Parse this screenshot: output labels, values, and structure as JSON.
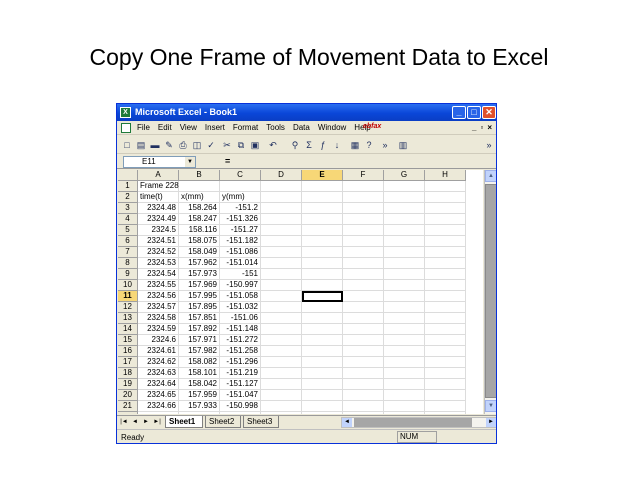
{
  "slide_title": "Copy One Frame of Movement Data to Excel",
  "window": {
    "app_icon": "X",
    "title": "Microsoft Excel - Book1",
    "minimize_glyph": "_",
    "maximize_glyph": "□",
    "close_glyph": "✕"
  },
  "menu": {
    "items": [
      "File",
      "Edit",
      "View",
      "Insert",
      "Format",
      "Tools",
      "Data",
      "Window",
      "Help"
    ],
    "ask_box": "ebfax",
    "doc_controls": [
      "_",
      "▫",
      "×"
    ]
  },
  "toolbar": {
    "icons": [
      "new-icon",
      "open-icon",
      "save-icon",
      "permission-icon",
      "print-icon",
      "print-preview-icon",
      "spelling-icon",
      "cut-icon",
      "copy-icon",
      "paste-icon",
      "undo-icon",
      "hyperlink-icon",
      "autosum-icon",
      "function-icon",
      "sort-ascending-icon",
      "chart-wizard-icon",
      "help-icon",
      "more-icon",
      "borders-icon"
    ],
    "glyphs": [
      "□",
      "▤",
      "▬",
      "✎",
      "⎙",
      "◫",
      "✓",
      "✂",
      "⧉",
      "▣",
      "↶",
      "⚲",
      "Σ",
      "ƒ",
      "↓",
      "▦",
      "?",
      "»",
      "▥"
    ],
    "overflow": "»"
  },
  "formula_bar": {
    "name_box": "E11",
    "name_box_dropdown": "▼",
    "equals": "="
  },
  "columns": [
    "A",
    "B",
    "C",
    "D",
    "E",
    "F",
    "G",
    "H"
  ],
  "active_column": "E",
  "active_row": "11",
  "rows": [
    {
      "n": "1",
      "cells": [
        "Frame 228",
        "",
        ""
      ]
    },
    {
      "n": "2",
      "cells": [
        "time(t)",
        "x(mm)",
        "y(mm)"
      ]
    },
    {
      "n": "3",
      "cells": [
        "2324.48",
        "158.264",
        "-151.2"
      ]
    },
    {
      "n": "4",
      "cells": [
        "2324.49",
        "158.247",
        "-151.326"
      ]
    },
    {
      "n": "5",
      "cells": [
        "2324.5",
        "158.116",
        "-151.27"
      ]
    },
    {
      "n": "6",
      "cells": [
        "2324.51",
        "158.075",
        "-151.182"
      ]
    },
    {
      "n": "7",
      "cells": [
        "2324.52",
        "158.049",
        "-151.086"
      ]
    },
    {
      "n": "8",
      "cells": [
        "2324.53",
        "157.962",
        "-151.014"
      ]
    },
    {
      "n": "9",
      "cells": [
        "2324.54",
        "157.973",
        "-151"
      ]
    },
    {
      "n": "10",
      "cells": [
        "2324.55",
        "157.969",
        "-150.997"
      ]
    },
    {
      "n": "11",
      "cells": [
        "2324.56",
        "157.995",
        "-151.058"
      ]
    },
    {
      "n": "12",
      "cells": [
        "2324.57",
        "157.895",
        "-151.032"
      ]
    },
    {
      "n": "13",
      "cells": [
        "2324.58",
        "157.851",
        "-151.06"
      ]
    },
    {
      "n": "14",
      "cells": [
        "2324.59",
        "157.892",
        "-151.148"
      ]
    },
    {
      "n": "15",
      "cells": [
        "2324.6",
        "157.971",
        "-151.272"
      ]
    },
    {
      "n": "16",
      "cells": [
        "2324.61",
        "157.982",
        "-151.258"
      ]
    },
    {
      "n": "17",
      "cells": [
        "2324.62",
        "158.082",
        "-151.296"
      ]
    },
    {
      "n": "18",
      "cells": [
        "2324.63",
        "158.101",
        "-151.219"
      ]
    },
    {
      "n": "19",
      "cells": [
        "2324.64",
        "158.042",
        "-151.127"
      ]
    },
    {
      "n": "20",
      "cells": [
        "2324.65",
        "157.959",
        "-151.047"
      ]
    },
    {
      "n": "21",
      "cells": [
        "2324.66",
        "157.933",
        "-150.998"
      ]
    }
  ],
  "sheet_tabs": [
    "Sheet1",
    "Sheet2",
    "Sheet3"
  ],
  "active_sheet": "Sheet1",
  "tab_nav": [
    "|◄",
    "◄",
    "►",
    "►|"
  ],
  "status": {
    "left": "Ready",
    "indicator": "NUM"
  },
  "colors": {
    "titlebar": "#0a46d8",
    "chrome": "#ece9d8",
    "active_header": "#f7d777"
  }
}
